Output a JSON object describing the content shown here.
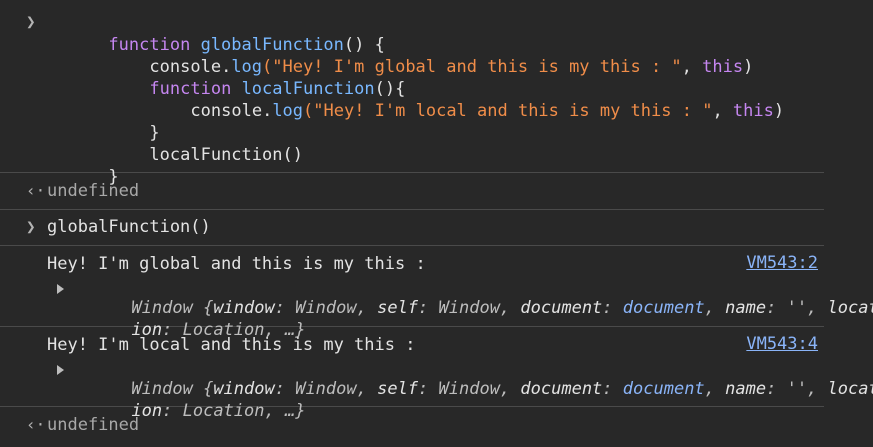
{
  "input1": {
    "lines": [
      {
        "t1": "function",
        "t2": " ",
        "t3": "globalFunction",
        "t4": "() {"
      },
      {
        "t1": "console.",
        "t2": "log",
        "t3": "(\"Hey! I'm global and this is my this : \"",
        "t4": ", ",
        "t5": "this",
        "t6": ")"
      },
      {
        "t1": "function",
        "t2": " ",
        "t3": "localFunction",
        "t4": "(){"
      },
      {
        "t1": "console.",
        "t2": "log",
        "t3": "(\"Hey! I'm local and this is my this : \"",
        "t4": ", ",
        "t5": "this",
        "t6": ")"
      },
      {
        "t1": "}"
      },
      {
        "t1": "localFunction()"
      },
      {
        "t1": "}"
      }
    ]
  },
  "result1": "undefined",
  "input2": "globalFunction()",
  "logs": [
    {
      "message": "Hey! I'm global and this is my this :",
      "source": "VM543:2",
      "obj_line1": {
        "a": "Window {",
        "b": "window",
        "c": ": Window, ",
        "d": "self",
        "e": ": Window, ",
        "f": "document",
        "g": ": ",
        "h": "document",
        "i": ", ",
        "j": "name",
        "k": ": '', ",
        "l": "locat"
      },
      "obj_line2": {
        "a": "ion",
        "b": ": Location, …}"
      }
    },
    {
      "message": "Hey! I'm local and this is my this :",
      "source": "VM543:4",
      "obj_line1": {
        "a": "Window {",
        "b": "window",
        "c": ": Window, ",
        "d": "self",
        "e": ": Window, ",
        "f": "document",
        "g": ": ",
        "h": "document",
        "i": ", ",
        "j": "name",
        "k": ": '', ",
        "l": "locat"
      },
      "obj_line2": {
        "a": "ion",
        "b": ": Location, …}"
      }
    }
  ],
  "result2": "undefined",
  "icons": {
    "prompt": "chevron-right-icon",
    "result": "return-arrow-icon",
    "expand": "expand-triangle-icon"
  },
  "colors": {
    "background": "#282828",
    "keyword": "#c586f0",
    "function_name": "#79b8ff",
    "string": "#f08d49",
    "link": "#8ab4f8"
  }
}
